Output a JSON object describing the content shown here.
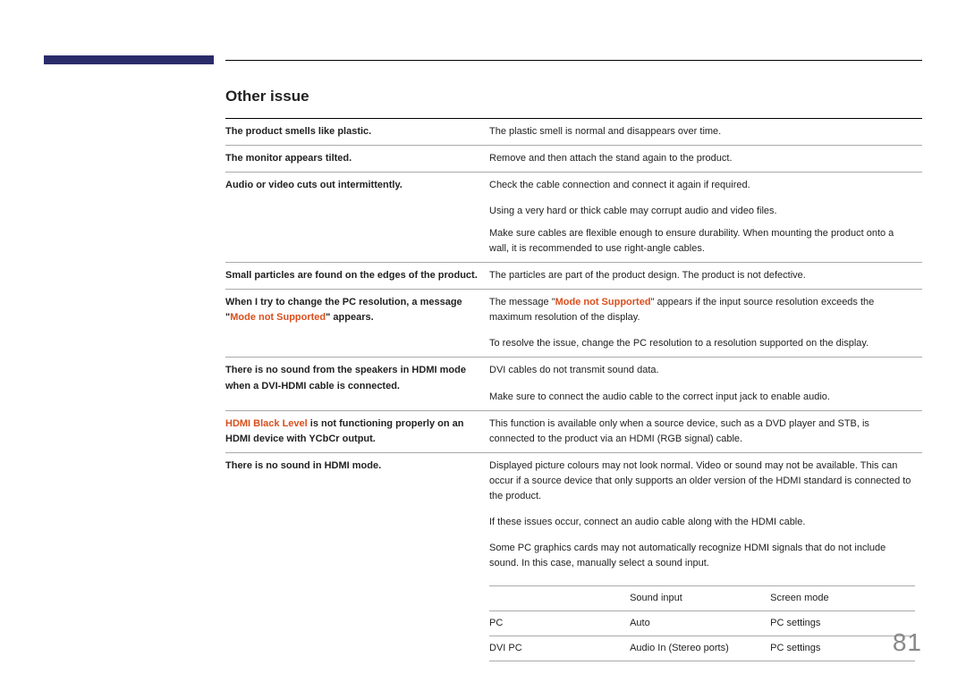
{
  "page_number": "81",
  "section_title": "Other issue",
  "rows": [
    {
      "issue_plain": "The product smells like plastic.",
      "solutions": [
        "The plastic smell is normal and disappears over time."
      ]
    },
    {
      "issue_plain": "The monitor appears tilted.",
      "solutions": [
        "Remove and then attach the stand again to the product."
      ]
    },
    {
      "issue_plain": "Audio or video cuts out intermittently.",
      "solutions": [
        "Check the cable connection and connect it again if required.",
        "Using a very hard or thick cable may corrupt audio and video files.\nMake sure cables are flexible enough to ensure durability. When mounting the product onto a wall, it is recommended to use right-angle cables."
      ]
    },
    {
      "issue_plain": "Small particles are found on the edges of the product.",
      "solutions": [
        "The particles are part of the product design. The product is not defective."
      ]
    },
    {
      "issue_parts": [
        {
          "text": "When I try to change the PC resolution, a message \"",
          "hl": false
        },
        {
          "text": "Mode not Supported",
          "hl": true
        },
        {
          "text": "\" appears.",
          "hl": false
        }
      ],
      "solution_rich": [
        [
          {
            "text": "The message \"",
            "hl": false
          },
          {
            "text": "Mode not Supported",
            "hl": true
          },
          {
            "text": "\" appears if the input source resolution exceeds the maximum resolution of the display.",
            "hl": false
          }
        ],
        [
          {
            "text": "To resolve the issue, change the PC resolution to a resolution supported on the display.",
            "hl": false
          }
        ]
      ]
    },
    {
      "issue_plain": "There is no sound from the speakers in HDMI mode when a DVI-HDMI cable is connected.",
      "solutions": [
        "DVI cables do not transmit sound data.",
        "Make sure to connect the audio cable to the correct input jack to enable audio."
      ]
    },
    {
      "issue_parts": [
        {
          "text": "HDMI Black Level",
          "hl": true
        },
        {
          "text": " is not functioning properly on an HDMI device with YCbCr output.",
          "hl": false
        }
      ],
      "solutions": [
        "This function is available only when a source device, such as a DVD player and STB, is connected to the product via an HDMI (RGB signal) cable."
      ]
    },
    {
      "issue_plain": "There is no sound in HDMI mode.",
      "solutions": [
        "Displayed picture colours may not look normal. Video or sound may not be available. This can occur if a source device that only supports an older version of the HDMI standard is connected to the product.",
        "If these issues occur, connect an audio cable along with the HDMI cable.",
        "Some PC graphics cards may not automatically recognize HDMI signals that do not include sound. In this case, manually select a sound input."
      ],
      "inner_table": {
        "header": [
          "",
          "Sound input",
          "Screen mode"
        ],
        "rows": [
          [
            "PC",
            "Auto",
            "PC settings"
          ],
          [
            "DVI PC",
            "Audio In (Stereo ports)",
            "PC settings"
          ]
        ]
      }
    }
  ]
}
